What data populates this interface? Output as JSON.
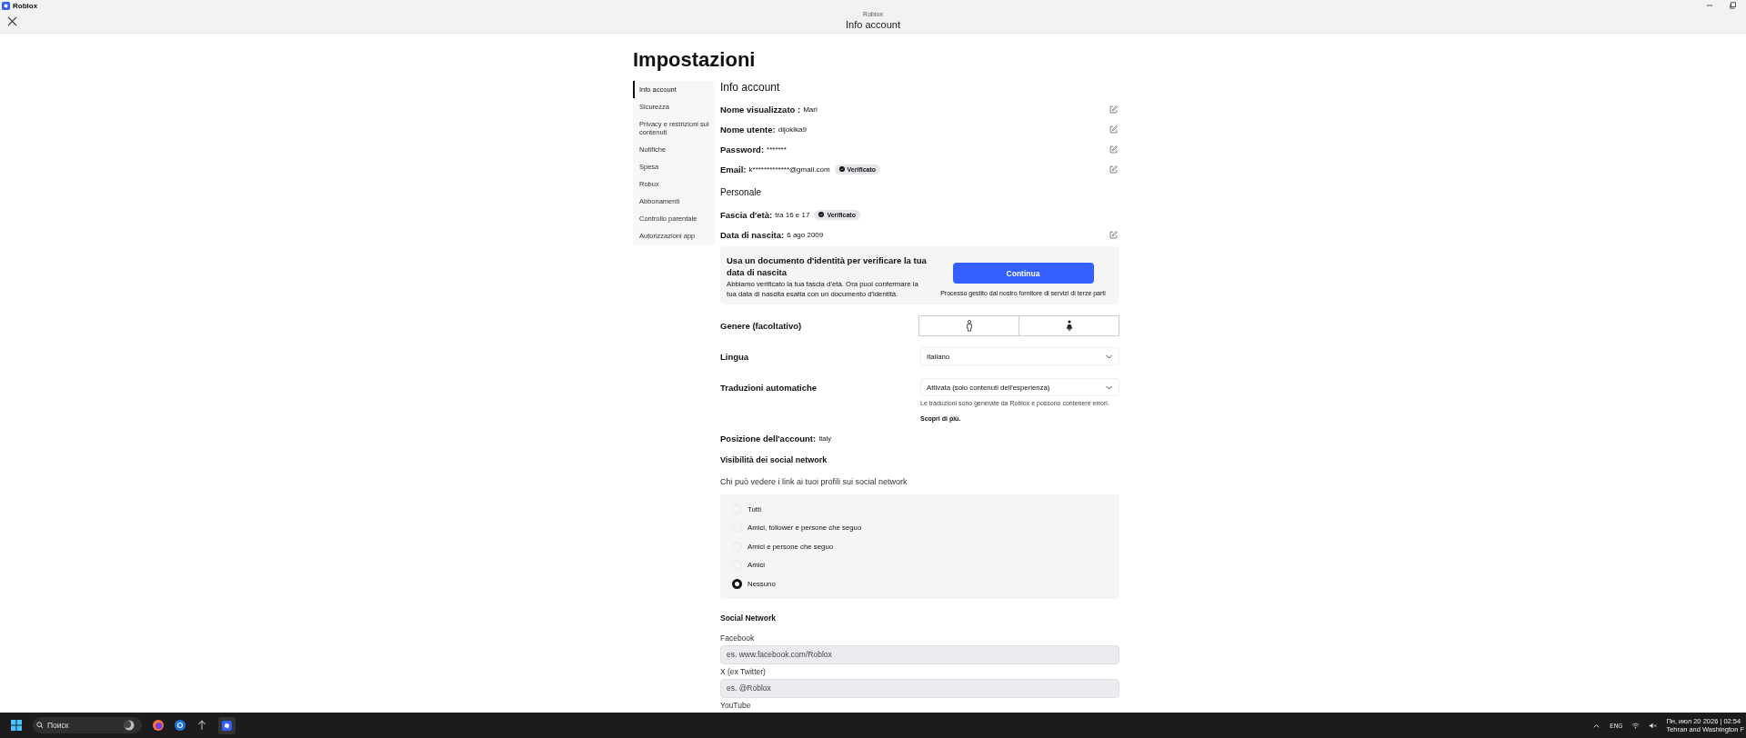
{
  "window": {
    "title": "Roblox"
  },
  "header": {
    "subtitle": "Roblox",
    "title": "Info account"
  },
  "page_title": "Impostazioni",
  "sidebar": {
    "items": [
      {
        "label": "Info account",
        "selected": true
      },
      {
        "label": "Sicurezza",
        "selected": false
      },
      {
        "label": "Privacy e restrizioni sui contenuti",
        "selected": false
      },
      {
        "label": "Notifiche",
        "selected": false
      },
      {
        "label": "Spesa",
        "selected": false
      },
      {
        "label": "Robux",
        "selected": false
      },
      {
        "label": "Abbonamenti",
        "selected": false
      },
      {
        "label": "Controllo parentale",
        "selected": false
      },
      {
        "label": "Autorizzazioni app",
        "selected": false
      }
    ]
  },
  "account": {
    "heading": "Info account",
    "fields": [
      {
        "label": "Nome visualizzato :",
        "value": "Mari",
        "editable": true
      },
      {
        "label": "Nome utente:",
        "value": "dijokika9",
        "editable": true
      },
      {
        "label": "Password:",
        "value": "*******",
        "editable": true
      },
      {
        "label": "Email:",
        "value": "k*************@gmail.com",
        "badge": "Verificato",
        "editable": true
      }
    ]
  },
  "personal": {
    "heading": "Personale",
    "fields": [
      {
        "label": "Fascia d'età:",
        "value": "tra 16 e 17",
        "badge": "Verificato"
      },
      {
        "label": "Data di nascita:",
        "value": "6 ago 2009",
        "editable": true
      }
    ]
  },
  "id_banner": {
    "title": "Usa un documento d'identità per verificare la tua data di nascita",
    "text": "Abbiamo verificato la tua fascia d'età. Ora puoi confermare la tua data di nascita esatta con un documento d'identità.",
    "button": "Continua",
    "note": "Processo gestito dal nostro fornitore di servizi di terze parti"
  },
  "gender": {
    "label": "Genere (facoltativo)",
    "options": [
      {
        "kind": "male",
        "selected": false
      },
      {
        "kind": "female",
        "selected": false
      }
    ]
  },
  "language": {
    "label": "Lingua",
    "value": "Italiano"
  },
  "translations": {
    "label": "Traduzioni automatiche",
    "value": "Attivata (solo contenuti dell'esperienza)",
    "note": "Le traduzioni sono generate da Roblox e possono contenere errori.",
    "link": "Scopri di più."
  },
  "location": {
    "label": "Posizione dell'account:",
    "value": "Italy"
  },
  "social_visibility": {
    "heading": "Visibilità dei social network",
    "question": "Chi può vedere i link ai tuoi profili sui social network",
    "options": [
      {
        "label": "Tutti",
        "selected": false
      },
      {
        "label": "Amici, follower e persone che seguo",
        "selected": false
      },
      {
        "label": "Amici e persone che seguo",
        "selected": false
      },
      {
        "label": "Amici",
        "selected": false
      },
      {
        "label": "Nessuno",
        "selected": true
      }
    ]
  },
  "social_links": {
    "heading": "Social Network",
    "fields": [
      {
        "label": "Facebook",
        "placeholder": "es. www.facebook.com/Roblox"
      },
      {
        "label": "X (ex Twitter)",
        "placeholder": "es. @Roblox"
      },
      {
        "label": "YouTube"
      }
    ]
  },
  "taskbar": {
    "search_placeholder": "Поиск",
    "language": "ENG",
    "date": "Пн, июл 20 2026 | 02:54",
    "timezone": "Tehran and Washington F"
  }
}
